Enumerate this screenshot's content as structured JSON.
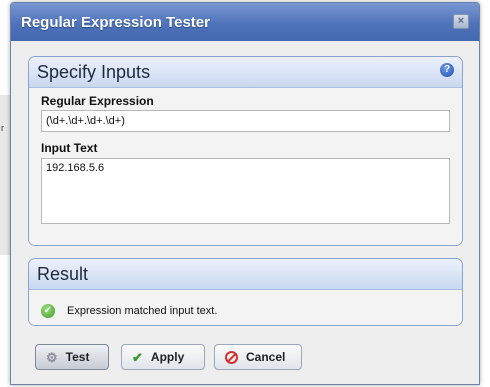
{
  "dialog": {
    "title": "Regular Expression Tester"
  },
  "inputs_panel": {
    "title": "Specify Inputs",
    "regex_label": "Regular Expression",
    "regex_value": "(\\d+.\\d+.\\d+.\\d+)",
    "input_label": "Input Text",
    "input_value": "192.168.5.6"
  },
  "result_panel": {
    "title": "Result",
    "message": "Expression matched input text."
  },
  "buttons": {
    "test": "Test",
    "apply": "Apply",
    "cancel": "Cancel"
  },
  "background": {
    "strip_text": "r"
  },
  "icons": {
    "help": "help-icon",
    "close": "close-icon",
    "success": "check-circle-icon",
    "test": "gear-icon",
    "apply": "checkmark-icon",
    "cancel": "cancel-icon"
  }
}
